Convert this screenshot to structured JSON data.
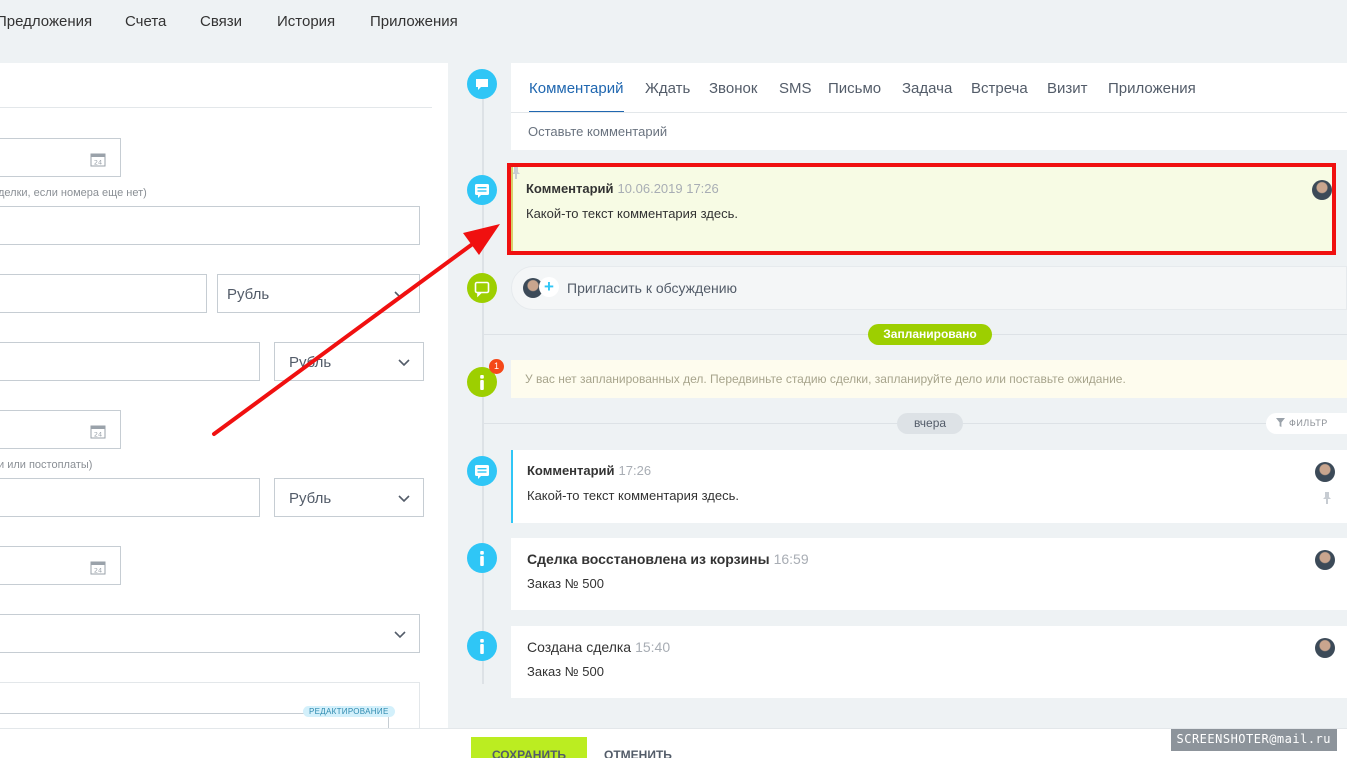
{
  "top_tabs": [
    "Предложения",
    "Счета",
    "Связи",
    "История",
    "Приложения"
  ],
  "left_form": {
    "date_icon_text": "24",
    "hint_1": "делки, если номера еще нет)",
    "hint_2": "и или постоплаты)",
    "currency_1": "Рубль",
    "currency_2": "Рубль",
    "currency_3": "Рубль",
    "edit_badge": "РЕДАКТИРОВАНИЕ"
  },
  "composer": {
    "tabs": [
      "Комментарий",
      "Ждать",
      "Звонок",
      "SMS",
      "Письмо",
      "Задача",
      "Встреча",
      "Визит",
      "Приложения"
    ],
    "active_tab": "Комментарий",
    "placeholder": "Оставьте комментарий"
  },
  "highlighted_comment": {
    "title": "Комментарий",
    "time": "10.06.2019 17:26",
    "text": "Какой-то текст комментария здесь."
  },
  "invite": {
    "text": "Пригласить к обсуждению",
    "plus": "+"
  },
  "planned": {
    "label": "Запланировано",
    "badge_count": "1",
    "text": "У вас нет запланированных дел. Передвиньте стадию сделки, запланируйте дело или поставьте ожидание."
  },
  "history": {
    "day_label": "вчера",
    "filter_label": "ФИЛЬТР",
    "items": [
      {
        "title": "Комментарий",
        "time": "17:26",
        "text": "Какой-то текст комментария здесь."
      },
      {
        "title": "Сделка восстановлена из корзины",
        "time": "16:59",
        "text": "Заказ № 500"
      },
      {
        "title": "Создана сделка",
        "time": "15:40",
        "text": "Заказ № 500"
      }
    ]
  },
  "footer": {
    "save": "СОХРАНИТЬ",
    "cancel": "ОТМЕНИТЬ"
  },
  "watermark": "SCREENSHOTER@mail.ru",
  "colors": {
    "accent_blue": "#2fc6f6",
    "accent_green": "#9dcf00",
    "highlight_red": "#f01010",
    "active_tab": "#2067b0",
    "save_button": "#bbed21"
  },
  "icons": [
    "calendar-icon",
    "chevron-down-icon",
    "chat-icon",
    "comment-icon",
    "info-icon",
    "pin-icon",
    "filter-icon",
    "arrow-annotation"
  ]
}
